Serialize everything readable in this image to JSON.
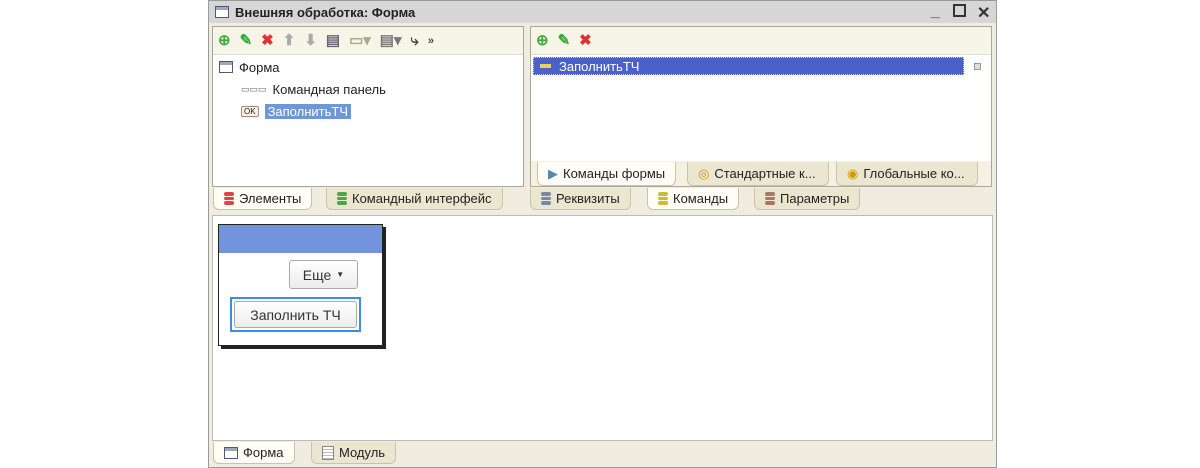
{
  "window": {
    "title": "Внешняя обработка: Форма"
  },
  "tree": {
    "items": [
      {
        "label": "Форма"
      },
      {
        "label": "Командная панель"
      },
      {
        "label": "ЗаполнитьТЧ"
      }
    ]
  },
  "left_tabs": [
    {
      "label": "Элементы"
    },
    {
      "label": "Командный интерфейс"
    }
  ],
  "commands": {
    "items": [
      {
        "label": "ЗаполнитьТЧ"
      }
    ]
  },
  "command_tabs": [
    {
      "label": "Команды формы"
    },
    {
      "label": "Стандартные к..."
    },
    {
      "label": "Глобальные ко..."
    }
  ],
  "right_tabs": [
    {
      "label": "Реквизиты"
    },
    {
      "label": "Команды"
    },
    {
      "label": "Параметры"
    }
  ],
  "preview": {
    "more_label": "Еще",
    "fill_button": "Заполнить ТЧ"
  },
  "bottom_tabs": [
    {
      "label": "Форма"
    },
    {
      "label": "Модуль"
    }
  ],
  "colors": {
    "selection": "#6f97d6",
    "list_selection": "#4a61c9",
    "preview_header": "#7393dc"
  }
}
